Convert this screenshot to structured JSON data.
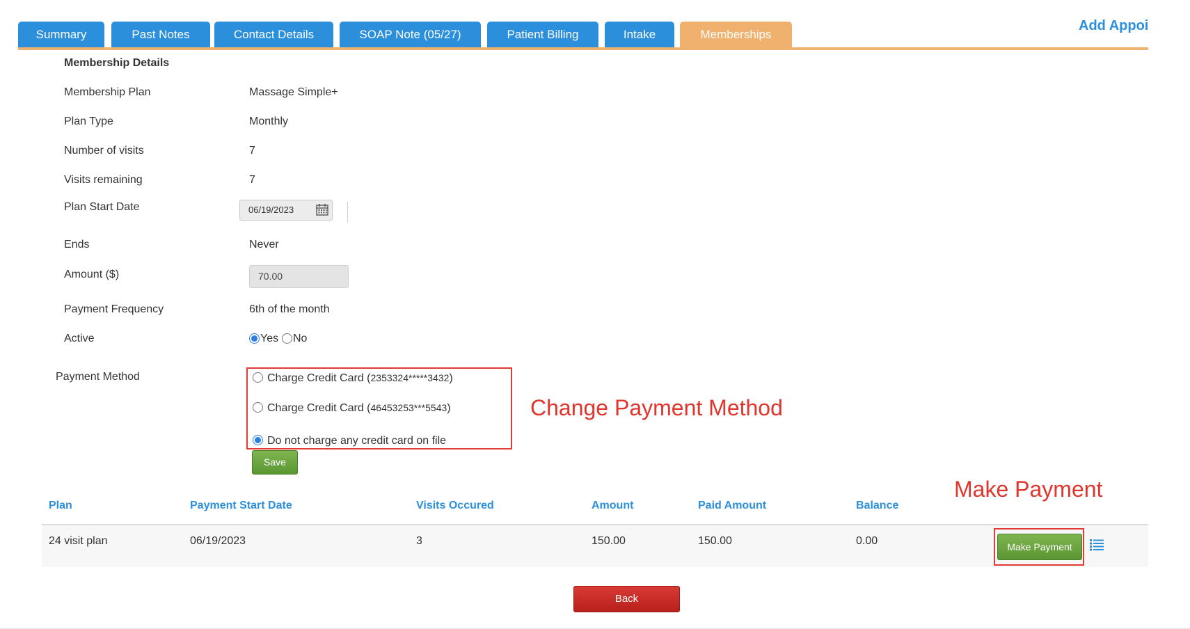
{
  "tabs": [
    {
      "label": "Summary"
    },
    {
      "label": "Past Notes"
    },
    {
      "label": "Contact Details"
    },
    {
      "label": "SOAP Note (05/27)"
    },
    {
      "label": "Patient Billing"
    },
    {
      "label": "Intake"
    },
    {
      "label": "Memberships",
      "active": true
    }
  ],
  "add_appointment_label": "Add Appoi",
  "section_title": "Membership Details",
  "details": {
    "plan_label": "Membership Plan",
    "plan_value": "Massage Simple+",
    "type_label": "Plan Type",
    "type_value": "Monthly",
    "visits_label": "Number of visits",
    "visits_value": "7",
    "remaining_label": "Visits remaining",
    "remaining_value": "7",
    "start_label": "Plan Start Date",
    "start_value": "06/19/2023",
    "ends_label": "Ends",
    "ends_value": "Never",
    "amount_label": "Amount ($)",
    "amount_value": "70.00",
    "frequency_label": "Payment Frequency",
    "frequency_value": "6th of the month",
    "active_label": "Active",
    "active_yes": "Yes",
    "active_no": "No",
    "active_selected": "Yes"
  },
  "payment_method": {
    "label": "Payment Method",
    "options": [
      {
        "prefix": "Charge Credit Card (",
        "number": "2353324*****3432",
        "suffix": ")",
        "checked": false
      },
      {
        "prefix": "Charge Credit Card (",
        "number": "46453253***5543",
        "suffix": ")",
        "checked": false
      },
      {
        "prefix": "Do not charge any credit card on file",
        "number": "",
        "suffix": "",
        "checked": true
      }
    ]
  },
  "save_label": "Save",
  "annotations": {
    "change_payment": "Change Payment Method",
    "make_payment": "Make Payment"
  },
  "table": {
    "headers": [
      "Plan",
      "Payment Start Date",
      "Visits Occured",
      "Amount",
      "Paid Amount",
      "Balance"
    ],
    "rows": [
      [
        "24 visit plan",
        "06/19/2023",
        "3",
        "150.00",
        "150.00",
        "0.00"
      ]
    ],
    "make_payment_label": "Make Payment"
  },
  "back_label": "Back",
  "colors": {
    "tab_blue": "#2b8fdc",
    "tab_active": "#f0b06e",
    "annotation_red": "#e0352d",
    "button_green": "#5a9632",
    "button_red": "#c52a25"
  },
  "icons": [
    "calendar-icon",
    "list-icon"
  ]
}
